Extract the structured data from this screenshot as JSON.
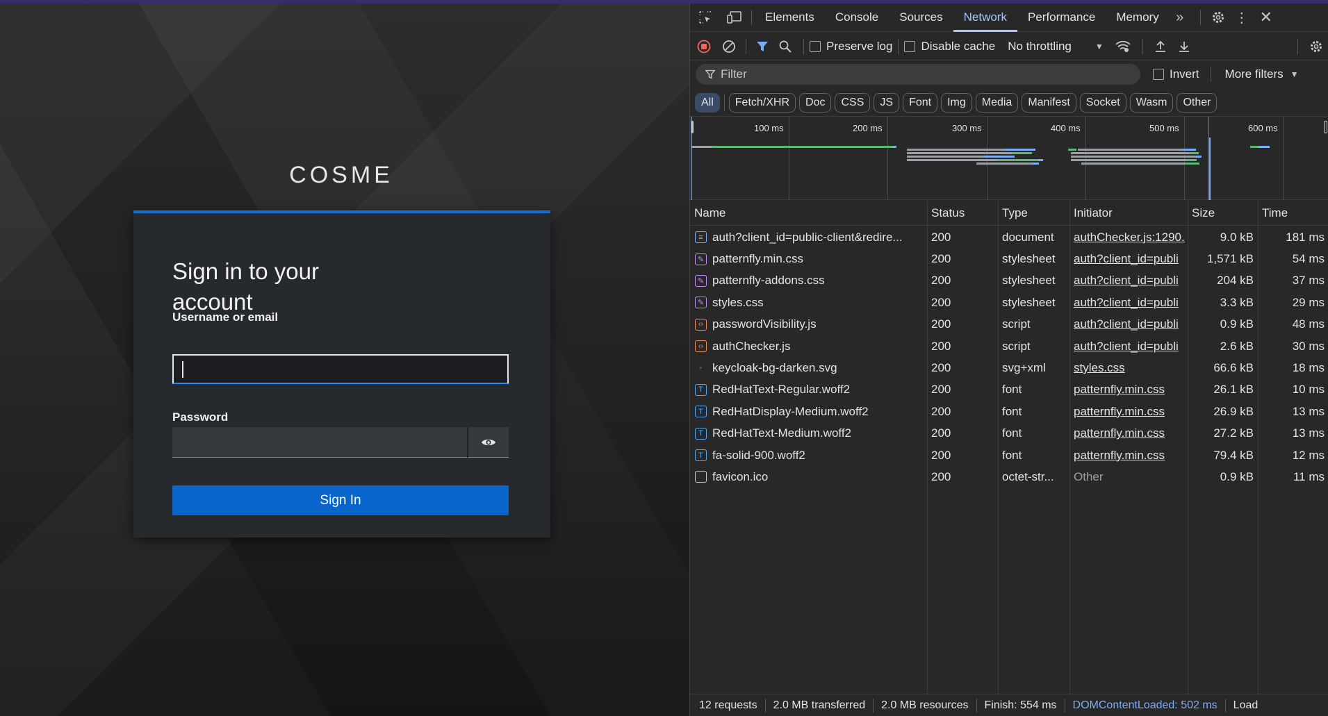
{
  "login": {
    "brand": "COSME",
    "heading": "Sign in to your account",
    "username_label": "Username or email",
    "username_value": "",
    "password_label": "Password",
    "signin_label": "Sign In"
  },
  "devtools": {
    "tabs": [
      "Elements",
      "Console",
      "Sources",
      "Network",
      "Performance",
      "Memory"
    ],
    "active_tab": "Network",
    "toolbar": {
      "preserve_log": "Preserve log",
      "disable_cache": "Disable cache",
      "throttling": "No throttling"
    },
    "filter": {
      "placeholder": "Filter",
      "invert": "Invert",
      "more_filters": "More filters"
    },
    "type_filters": [
      "All",
      "Fetch/XHR",
      "Doc",
      "CSS",
      "JS",
      "Font",
      "Img",
      "Media",
      "Manifest",
      "Socket",
      "Wasm",
      "Other"
    ],
    "timeline_ticks": [
      "100 ms",
      "200 ms",
      "300 ms",
      "400 ms",
      "500 ms",
      "600 ms"
    ],
    "columns": [
      "Name",
      "Status",
      "Type",
      "Initiator",
      "Size",
      "Time"
    ],
    "requests": [
      {
        "name": "auth?client_id=public-client&redire...",
        "status": "200",
        "type": "document",
        "initiator": "authChecker.js:1290.",
        "size": "9.0 kB",
        "time": "181 ms",
        "icon": "document-icon"
      },
      {
        "name": "patternfly.min.css",
        "status": "200",
        "type": "stylesheet",
        "initiator": "auth?client_id=publi",
        "size": "1,571 kB",
        "time": "54 ms",
        "icon": "stylesheet-icon"
      },
      {
        "name": "patternfly-addons.css",
        "status": "200",
        "type": "stylesheet",
        "initiator": "auth?client_id=publi",
        "size": "204 kB",
        "time": "37 ms",
        "icon": "stylesheet-icon"
      },
      {
        "name": "styles.css",
        "status": "200",
        "type": "stylesheet",
        "initiator": "auth?client_id=publi",
        "size": "3.3 kB",
        "time": "29 ms",
        "icon": "stylesheet-icon"
      },
      {
        "name": "passwordVisibility.js",
        "status": "200",
        "type": "script",
        "initiator": "auth?client_id=publi",
        "size": "0.9 kB",
        "time": "48 ms",
        "icon": "script-icon"
      },
      {
        "name": "authChecker.js",
        "status": "200",
        "type": "script",
        "initiator": "auth?client_id=publi",
        "size": "2.6 kB",
        "time": "30 ms",
        "icon": "script-icon"
      },
      {
        "name": "keycloak-bg-darken.svg",
        "status": "200",
        "type": "svg+xml",
        "initiator": "styles.css",
        "size": "66.6 kB",
        "time": "18 ms",
        "icon": "image-icon"
      },
      {
        "name": "RedHatText-Regular.woff2",
        "status": "200",
        "type": "font",
        "initiator": "patternfly.min.css",
        "size": "26.1 kB",
        "time": "10 ms",
        "icon": "font-icon"
      },
      {
        "name": "RedHatDisplay-Medium.woff2",
        "status": "200",
        "type": "font",
        "initiator": "patternfly.min.css",
        "size": "26.9 kB",
        "time": "13 ms",
        "icon": "font-icon"
      },
      {
        "name": "RedHatText-Medium.woff2",
        "status": "200",
        "type": "font",
        "initiator": "patternfly.min.css",
        "size": "27.2 kB",
        "time": "13 ms",
        "icon": "font-icon"
      },
      {
        "name": "fa-solid-900.woff2",
        "status": "200",
        "type": "font",
        "initiator": "patternfly.min.css",
        "size": "79.4 kB",
        "time": "12 ms",
        "icon": "font-icon"
      },
      {
        "name": "favicon.ico",
        "status": "200",
        "type": "octet-str...",
        "initiator": "Other",
        "size": "0.9 kB",
        "time": "11 ms",
        "icon": "other-icon"
      }
    ],
    "status_bar": {
      "requests": "12 requests",
      "transferred": "2.0 MB transferred",
      "resources": "2.0 MB resources",
      "finish": "Finish: 554 ms",
      "dom_content_loaded": "DOMContentLoaded: 502 ms",
      "load": "Load"
    },
    "colors": {
      "accent": "#a8c7fa",
      "dcl_blue": "#7cacf8",
      "signin_blue": "#0a66cc"
    }
  }
}
